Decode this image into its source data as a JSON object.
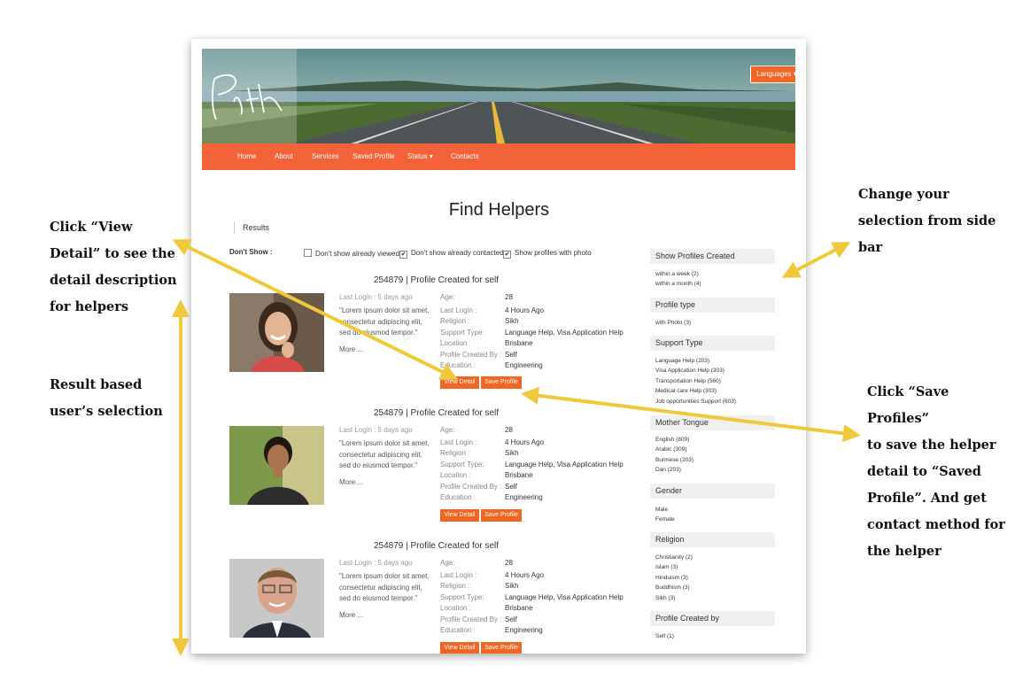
{
  "annotations": {
    "view_detail": [
      "Click “View",
      "Detail” to see the",
      "detail description",
      "for helpers"
    ],
    "result_based": [
      "Result based",
      "user’s selection"
    ],
    "change_selection": [
      "Change your",
      "selection from side",
      "bar"
    ],
    "save_profiles": [
      "Click “Save Profiles”",
      "to save the helper",
      "detail to “Saved",
      "Profile”. And get",
      "contact method for",
      "the helper"
    ]
  },
  "colors": {
    "accent": "#f26522",
    "nav": "#f4623a",
    "annotation_arrow": "#f0c93a"
  },
  "header": {
    "logo_text": "Path",
    "languages_label": "Languages ▾"
  },
  "nav": [
    "Home",
    "About",
    "Services",
    "Saved Profile",
    "Status ▾",
    "Contacts"
  ],
  "page": {
    "title": "Find Helpers",
    "breadcrumb": "Results"
  },
  "filters": {
    "label": "Don't Show :",
    "options": [
      {
        "label": "Don't show already viewed",
        "checked": false
      },
      {
        "label": "Don't show already contacted",
        "checked": true
      },
      {
        "label": "Show profiles with photo",
        "checked": true
      }
    ]
  },
  "profiles": [
    {
      "title": "254879 | Profile Created for self",
      "last_login_short": "Last Login : 5 days ago",
      "description": "\"Lorem ipsum dolor sit amet, consectetur adipiscing elit, sed do eiusmod tempor.\"",
      "more": "More ...",
      "details": [
        [
          "Age:",
          "28"
        ],
        [
          "Last Login :",
          "4 Hours Ago"
        ],
        [
          "Religion :",
          "Sikh"
        ],
        [
          "Support Type:",
          "Language Help, Visa Application Help"
        ],
        [
          "Location :",
          "Brisbane"
        ],
        [
          "Profile Created By :",
          "Self"
        ],
        [
          "Education :",
          "Engineering"
        ]
      ],
      "view_label": "View Detail",
      "save_label": "Save Profile"
    },
    {
      "title": "254879 | Profile Created for self",
      "last_login_short": "Last Login : 5 days ago",
      "description": "\"Lorem ipsum dolor sit amet, consectetur adipiscing elit, sed do eiusmod tempor.\"",
      "more": "More ...",
      "details": [
        [
          "Age:",
          "28"
        ],
        [
          "Last Login :",
          "4 Hours Ago"
        ],
        [
          "Religion :",
          "Sikh"
        ],
        [
          "Support Type:",
          "Language Help, Visa Application Help"
        ],
        [
          "Location :",
          "Brisbane"
        ],
        [
          "Profile Created By :",
          "Self"
        ],
        [
          "Education :",
          "Engineering"
        ]
      ],
      "view_label": "View Detail",
      "save_label": "Save Profile"
    },
    {
      "title": "254879 | Profile Created for self",
      "last_login_short": "Last Login : 5 days ago",
      "description": "\"Lorem ipsum dolor sit amet, consectetur adipiscing elit, sed do eiusmod tempor.\"",
      "more": "More ...",
      "details": [
        [
          "Age:",
          "28"
        ],
        [
          "Last Login :",
          "4 Hours Ago"
        ],
        [
          "Religion :",
          "Sikh"
        ],
        [
          "Support Type:",
          "Language Help, Visa Application Help"
        ],
        [
          "Location :",
          "Brisbane"
        ],
        [
          "Profile Created By :",
          "Self"
        ],
        [
          "Education :",
          "Engineering"
        ]
      ],
      "view_label": "View Detail",
      "save_label": "Save Profile"
    }
  ],
  "sidebar": [
    {
      "title": "Show Profiles Created",
      "items": [
        "within a week (2)",
        "within a month (4)"
      ]
    },
    {
      "title": "Profile type",
      "items": [
        "with Photo (3)"
      ]
    },
    {
      "title": "Support Type",
      "items": [
        "Language Help (203)",
        "Visa Application Help (303)",
        "Transportation Help (560)",
        "Medical care Help (303)",
        "Job opportunities Support (603)"
      ]
    },
    {
      "title": "Mother Tongue",
      "items": [
        "English (809)",
        "Arabic (309)",
        "Burmese (203)",
        "Dari (203)"
      ]
    },
    {
      "title": "Gender",
      "items": [
        "Male",
        "Female"
      ]
    },
    {
      "title": "Religion",
      "items": [
        "Christianity (2)",
        "Islam (3)",
        "Hinduism (3)",
        "Buddhism (3)",
        "Sikh (3)"
      ]
    },
    {
      "title": "Profile Created by",
      "items": [
        "Self (1)"
      ]
    }
  ]
}
